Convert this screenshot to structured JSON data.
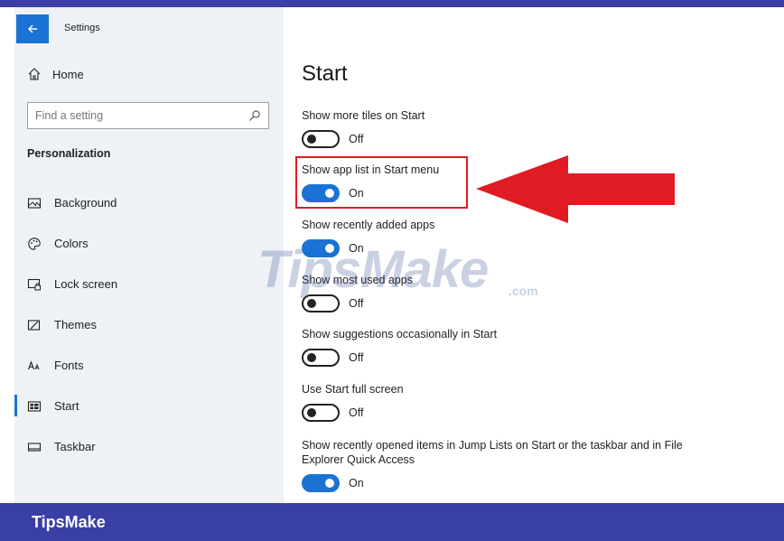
{
  "window": {
    "title": "Settings",
    "back_icon": "arrow-left-icon"
  },
  "sidebar": {
    "home_label": "Home",
    "search_placeholder": "Find a setting",
    "section_heading": "Personalization",
    "items": [
      {
        "label": "Background",
        "icon": "picture-icon"
      },
      {
        "label": "Colors",
        "icon": "palette-icon"
      },
      {
        "label": "Lock screen",
        "icon": "lock-screen-icon"
      },
      {
        "label": "Themes",
        "icon": "brush-icon"
      },
      {
        "label": "Fonts",
        "icon": "font-icon"
      },
      {
        "label": "Start",
        "icon": "start-tiles-icon",
        "active": true
      },
      {
        "label": "Taskbar",
        "icon": "taskbar-icon"
      }
    ]
  },
  "main": {
    "title": "Start",
    "settings": [
      {
        "label": "Show more tiles on Start",
        "state": "Off"
      },
      {
        "label": "Show app list in Start menu",
        "state": "On"
      },
      {
        "label": "Show recently added apps",
        "state": "On"
      },
      {
        "label": "Show most used apps",
        "state": "Off"
      },
      {
        "label": "Show suggestions occasionally in Start",
        "state": "Off"
      },
      {
        "label": "Use Start full screen",
        "state": "Off"
      },
      {
        "label": "Show recently opened items in Jump Lists on Start or the taskbar and in File Explorer Quick Access",
        "state": "On"
      }
    ]
  },
  "annotation": {
    "highlight_color": "#e01b24",
    "arrow_color": "#e01b24"
  },
  "watermark": {
    "text": "TipsMake",
    "suffix": ".com"
  },
  "footer": {
    "brand": "TipsMake"
  },
  "colors": {
    "accent": "#1a73d4",
    "frame": "#3a3fa6",
    "sidebar_bg": "#eef1f5"
  }
}
